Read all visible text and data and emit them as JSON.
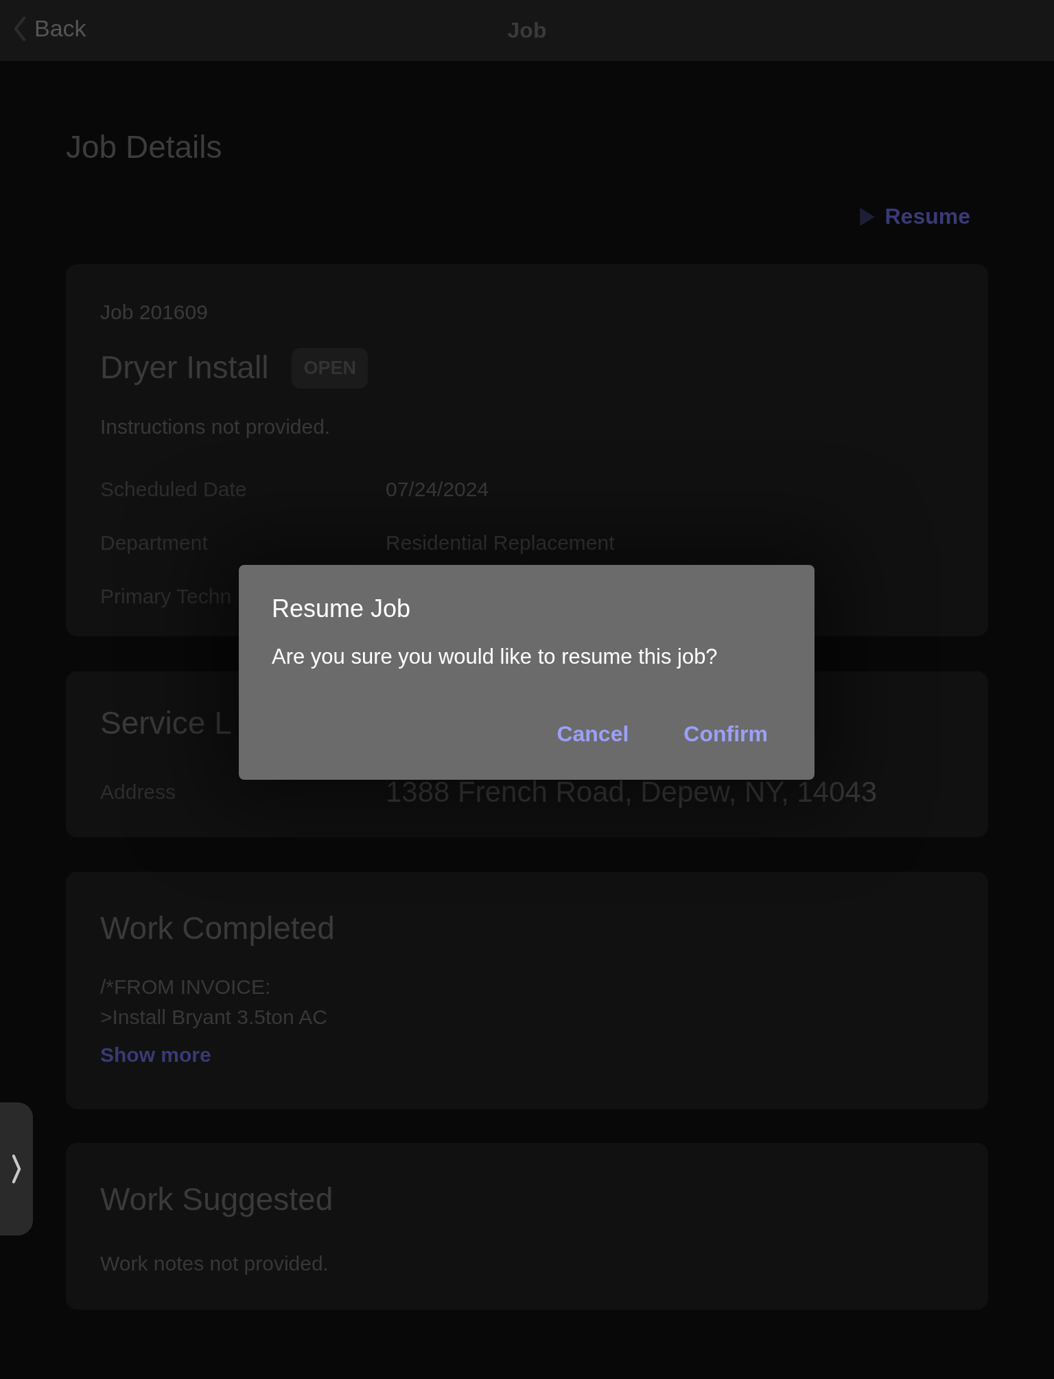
{
  "header": {
    "back_label": "Back",
    "title": "Job"
  },
  "page_title": "Job Details",
  "resume_action": {
    "label": "Resume"
  },
  "job_card": {
    "job_number": "Job 201609",
    "title": "Dryer Install",
    "status": "OPEN",
    "instructions": "Instructions not provided.",
    "fields": [
      {
        "label": "Scheduled Date",
        "value": "07/24/2024"
      },
      {
        "label": "Department",
        "value": "Residential Replacement"
      },
      {
        "label": "Primary Techn"
      }
    ]
  },
  "service_location": {
    "title": "Service L",
    "fields": [
      {
        "label": "Address",
        "value": "1388 French Road, Depew, NY, 14043"
      }
    ]
  },
  "work_completed": {
    "title": "Work Completed",
    "lines": [
      "/*FROM INVOICE:",
      ">Install Bryant 3.5ton AC"
    ],
    "show_more": "Show more"
  },
  "work_suggested": {
    "title": "Work Suggested",
    "notes": "Work notes not provided."
  },
  "dialog": {
    "title": "Resume Job",
    "message": "Are you sure you would like to resume this job?",
    "buttons": [
      {
        "label": "Cancel"
      },
      {
        "label": "Confirm"
      }
    ]
  }
}
